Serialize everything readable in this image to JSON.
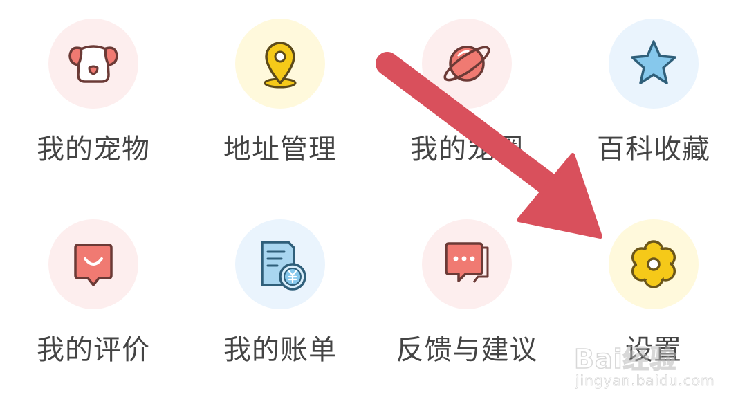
{
  "menu": {
    "items": [
      {
        "label": "我的宠物",
        "icon": "pet-dog-face-icon",
        "bg": "#fdeeee",
        "accent": "#f07a72"
      },
      {
        "label": "地址管理",
        "icon": "location-pin-icon",
        "bg": "#fff9dc",
        "accent": "#f5c919"
      },
      {
        "label": "我的宠圈",
        "icon": "planet-icon",
        "bg": "#fdeeee",
        "accent": "#f07a72"
      },
      {
        "label": "百科收藏",
        "icon": "star-icon",
        "bg": "#eaf4fd",
        "accent": "#86c8ec"
      },
      {
        "label": "我的评价",
        "icon": "smile-bubble-icon",
        "bg": "#fdeeee",
        "accent": "#f07a72"
      },
      {
        "label": "我的账单",
        "icon": "bill-yuan-icon",
        "bg": "#eaf4fd",
        "accent": "#86c8ec"
      },
      {
        "label": "反馈与建议",
        "icon": "chat-bubble-icon",
        "bg": "#fdeeee",
        "accent": "#f07a72"
      },
      {
        "label": "设置",
        "icon": "gear-icon",
        "bg": "#fff9dc",
        "accent": "#f5c919"
      }
    ]
  },
  "annotation": {
    "arrow_color": "#d9505c"
  },
  "watermark": {
    "brand": "Bai经验",
    "url": "jingyan.baidu.com"
  }
}
